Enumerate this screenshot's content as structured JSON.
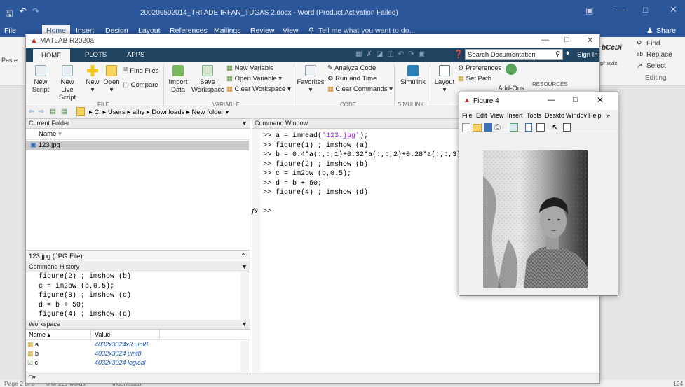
{
  "word": {
    "title": "200209502014_TRI ADE IRFAN_TUGAS 2.docx - Word (Product Activation Failed)",
    "tabs": [
      "File",
      "Home",
      "Insert",
      "Design",
      "Layout",
      "References",
      "Mailings",
      "Review",
      "View"
    ],
    "tell_me": "Tell me what you want to do...",
    "share": "Share",
    "paste": "Paste",
    "ribbon_right": {
      "style": "bCcDi",
      "emphasis": "phasis",
      "find": "Find",
      "replace": "Replace",
      "select": "Select",
      "editing": "Editing"
    },
    "status": {
      "page": "Page 2 of 3",
      "words": "6 of 129 words",
      "language": "Indonesian",
      "zoom": "124"
    }
  },
  "matlab": {
    "title": "MATLAB R2020a",
    "tabs": [
      "HOME",
      "PLOTS",
      "APPS"
    ],
    "search_placeholder": "Search Documentation",
    "sign_in": "Sign In",
    "file": {
      "new_script": [
        "New",
        "Script"
      ],
      "new_live_script": [
        "New",
        "Live Script"
      ],
      "new": "New",
      "open": "Open",
      "find_files": "Find Files",
      "compare": "Compare",
      "label": "FILE"
    },
    "variable": {
      "import_data": [
        "Import",
        "Data"
      ],
      "save_workspace": [
        "Save",
        "Workspace"
      ],
      "new_variable": "New Variable",
      "open_variable": "Open Variable",
      "clear_workspace": "Clear Workspace",
      "label": "VARIABLE"
    },
    "code": {
      "favorites": "Favorites",
      "analyze_code": "Analyze Code",
      "run_and_time": "Run and Time",
      "clear_commands": "Clear Commands",
      "label": "CODE"
    },
    "simulink": {
      "simulink": "Simulink",
      "label": "SIMULINK"
    },
    "environment": {
      "layout": "Layout",
      "preferences": "Preferences",
      "set_path": "Set Path"
    },
    "resources": {
      "add_ons": "Add-Ons",
      "label": "RESOURCES"
    },
    "path": [
      "C:",
      "Users",
      "alhy",
      "Downloads",
      "New folder"
    ],
    "current_folder": {
      "title": "Current Folder",
      "name_col": "Name",
      "file": "123.jpg",
      "details": "123.jpg (JPG File)"
    },
    "command_history": {
      "title": "Command History",
      "lines": [
        "figure(2) ; imshow (b)",
        "c = im2bw (b,0.5);",
        "figure(3) ; imshow (c)",
        "d = b + 50;",
        "figure(4) ; imshow (d)"
      ]
    },
    "workspace": {
      "title": "Workspace",
      "col_name": "Name",
      "col_value": "Value",
      "rows": [
        {
          "name": "a",
          "value": "4032x3024x3 uint8"
        },
        {
          "name": "b",
          "value": "4032x3024 uint8"
        },
        {
          "name": "c",
          "value": "4032x3024 logical"
        }
      ]
    },
    "command_window": {
      "title": "Command Window",
      "prompt": ">>",
      "fx": "fx",
      "lines": [
        {
          "pre": "a = imread(",
          "str": "'123.jpg'",
          "post": ");"
        },
        {
          "pre": "figure(1) ; imshow (a)",
          "str": "",
          "post": ""
        },
        {
          "pre": "b = 0.4*a(:,:,1)+0.32*a(:,:,2)+0.28*a(:,:,3);",
          "str": "",
          "post": ""
        },
        {
          "pre": "figure(2) ; imshow (b)",
          "str": "",
          "post": ""
        },
        {
          "pre": "c = im2bw (b,0.5);",
          "str": "",
          "post": ""
        },
        {
          "pre": "d = b + 50;",
          "str": "",
          "post": ""
        },
        {
          "pre": "figure(4) ; imshow (d)",
          "str": "",
          "post": ""
        }
      ]
    }
  },
  "figure": {
    "title": "Figure 4",
    "menu": [
      "File",
      "Edit",
      "View",
      "Insert",
      "Tools",
      "Deskto",
      "Windov",
      "Help"
    ]
  },
  "colors": {
    "word_blue": "#2b579a",
    "matlab_dark": "#20445f",
    "string_purple": "#a020f0",
    "link_blue": "#1f5fb5"
  }
}
